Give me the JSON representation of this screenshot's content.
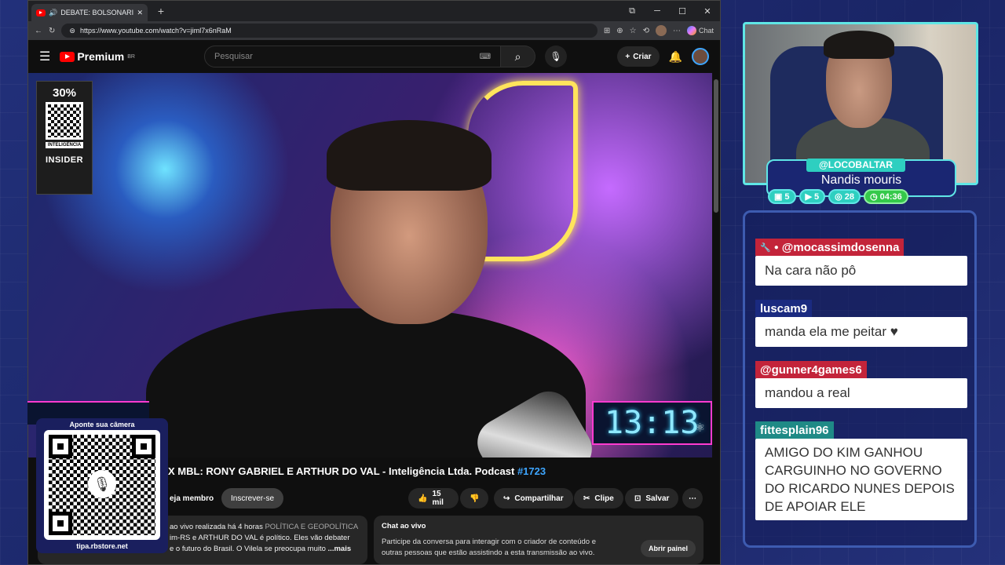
{
  "browser": {
    "tab_title": "DEBATE: BOLSONARISTA X M…",
    "url": "https://www.youtube.com/watch?v=jiml7x6nRaM",
    "chat_label": "Chat"
  },
  "youtube": {
    "brand": "Premium",
    "region": "BR",
    "search_placeholder": "Pesquisar",
    "create_label": "Criar",
    "video_title_main": "X MBL: RONY GABRIEL E ARTHUR DO VAL - Inteligência Ltda. Podcast",
    "video_title_tag": "#1723",
    "join_label": "eja membro",
    "subscribe_label": "Inscrever-se",
    "likes": "15 mil",
    "share_label": "Compartilhar",
    "clip_label": "Clipe",
    "save_label": "Salvar",
    "description_line1": "ao vivo realizada há 4 horas",
    "description_cat": "POLÍTICA E GEOPOLÍTICA",
    "description_line2": "im-RS e ARTHUR DO VAL é político. Eles vão debater",
    "description_line3": "e o futuro do Brasil. O Vilela se preocupa muito",
    "description_more": "...mais",
    "live_chat_title": "Chat ao vivo",
    "live_chat_text": "Participe da conversa para interagir com o criador de conteúdo e outras pessoas que estão assistindo a esta transmissão ao vivo.",
    "open_panel_label": "Abrir painel"
  },
  "overlay": {
    "promo_pct": "30%",
    "promo_label": "INTELIGÊNCIA",
    "promo_brand": "INSIDER",
    "clock": "13:13",
    "qr_top": "Aponte sua câmera",
    "qr_bottom": "tipa.rbstore.net"
  },
  "stream": {
    "handle": "@LOCOBALTAR",
    "name": "Nandis mouris",
    "stats": [
      {
        "icon": "twitch-icon",
        "value": "5"
      },
      {
        "icon": "youtube-icon",
        "value": "5"
      },
      {
        "icon": "kick-icon",
        "value": "28"
      },
      {
        "icon": "clock-icon",
        "value": "04:36"
      }
    ],
    "chat": [
      {
        "user": "@mocassimdosenna",
        "text": "Na cara não pô"
      },
      {
        "user": "luscam9",
        "text": "manda ela me peitar ♥"
      },
      {
        "user": "@gunner4games6",
        "text": "mandou a real"
      },
      {
        "user": "fittesplain96",
        "text": "AMIGO DO KIM GANHOU CARGUINHO NO GOVERNO DO RICARDO NUNES DEPOIS DE APOIAR ELE"
      }
    ]
  }
}
